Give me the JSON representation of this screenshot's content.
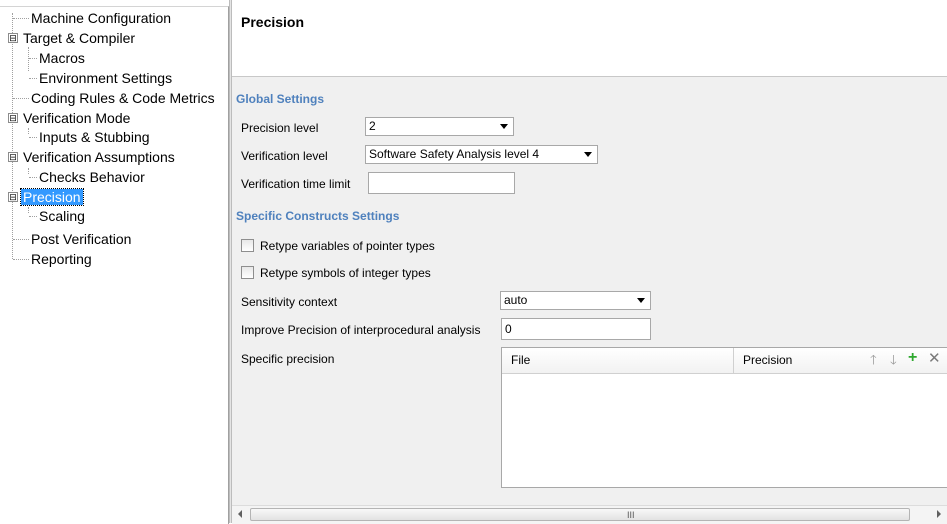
{
  "tree": {
    "items": [
      {
        "label": "Machine Configuration"
      },
      {
        "label": "Target & Compiler"
      },
      {
        "label": "Macros"
      },
      {
        "label": "Environment Settings"
      },
      {
        "label": "Coding Rules & Code Metrics"
      },
      {
        "label": "Verification Mode"
      },
      {
        "label": "Inputs & Stubbing"
      },
      {
        "label": "Verification Assumptions"
      },
      {
        "label": "Checks Behavior"
      },
      {
        "label": "Precision"
      },
      {
        "label": "Scaling"
      },
      {
        "label": "Post Verification"
      },
      {
        "label": "Reporting"
      }
    ],
    "expander_symbol": "⊟",
    "selected": "Precision"
  },
  "panel": {
    "title": "Precision",
    "global_settings": {
      "heading": "Global Settings",
      "precision_level": {
        "label": "Precision level",
        "value": "2"
      },
      "verification_level": {
        "label": "Verification level",
        "value": "Software Safety Analysis level 4"
      },
      "verification_time_limit": {
        "label": "Verification time limit",
        "value": ""
      }
    },
    "specific_constructs": {
      "heading": "Specific Constructs Settings",
      "retype_pointer": {
        "label": "Retype variables of pointer types",
        "checked": false
      },
      "retype_integer": {
        "label": "Retype symbols of integer types",
        "checked": false
      },
      "sensitivity_context": {
        "label": "Sensitivity context",
        "value": "auto"
      },
      "improve_precision": {
        "label": "Improve Precision of interprocedural analysis",
        "value": "0"
      },
      "specific_precision": {
        "label": "Specific precision",
        "columns": [
          "File",
          "Precision"
        ],
        "rows": []
      }
    }
  },
  "icons": {
    "up": "up-arrow-icon",
    "down": "down-arrow-icon",
    "add": "plus-icon",
    "remove": "close-icon",
    "add_color": "#2ea82e"
  },
  "scrollbar": {
    "grip": "III"
  }
}
